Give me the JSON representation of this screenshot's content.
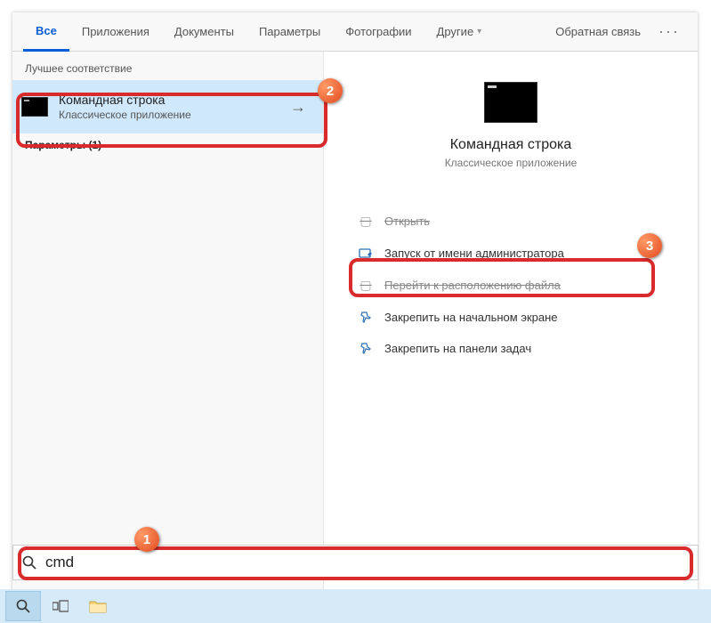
{
  "tabs": {
    "all": "Все",
    "apps": "Приложения",
    "docs": "Документы",
    "params": "Параметры",
    "photos": "Фотографии",
    "other": "Другие"
  },
  "feedback": "Обратная связь",
  "left": {
    "section": "Лучшее соответствие",
    "match_title": "Командная строка",
    "match_sub": "Классическое приложение",
    "params_row": "Параметры (1)"
  },
  "right": {
    "title": "Командная строка",
    "sub": "Классическое приложение",
    "actions": {
      "open": "Открыть",
      "run_admin": "Запуск от имени администратора",
      "open_location": "Перейти к расположению файла",
      "pin_start": "Закрепить на начальном экране",
      "pin_taskbar": "Закрепить на панели задач"
    }
  },
  "search": {
    "value": "cmd"
  },
  "badges": {
    "b1": "1",
    "b2": "2",
    "b3": "3"
  }
}
